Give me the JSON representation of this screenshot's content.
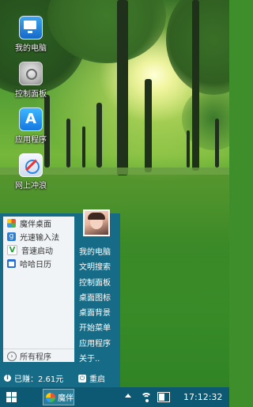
{
  "desktop": {
    "icons": [
      {
        "label": "我的电脑",
        "icon": "my-computer-icon"
      },
      {
        "label": "控制面板",
        "icon": "control-panel-icon"
      },
      {
        "label": "应用程序",
        "icon": "app-store-icon"
      },
      {
        "label": "网上冲浪",
        "icon": "browser-icon"
      }
    ]
  },
  "start_menu": {
    "apps": [
      {
        "label": "魔伴桌面",
        "icon": "moban-desktop-icon"
      },
      {
        "label": "光速输入法",
        "icon": "input-method-icon"
      },
      {
        "label": "音速启动",
        "icon": "quick-launch-icon"
      },
      {
        "label": "哈哈日历",
        "icon": "calendar-icon"
      }
    ],
    "all_programs": "所有程序",
    "links": [
      "我的电脑",
      "文明搜索",
      "控制面板",
      "桌面图标",
      "桌面背景",
      "开始菜单",
      "应用程序",
      "关于.."
    ],
    "earned": "已赚：2.61元",
    "restart": "重启"
  },
  "taskbar": {
    "app_label": "魔伴",
    "clock": "17:12:32"
  },
  "colors": {
    "start_menu_bg": "#166b86",
    "taskbar_bg": "#0d5872",
    "menu_panel_bg": "#f1f4f7"
  }
}
